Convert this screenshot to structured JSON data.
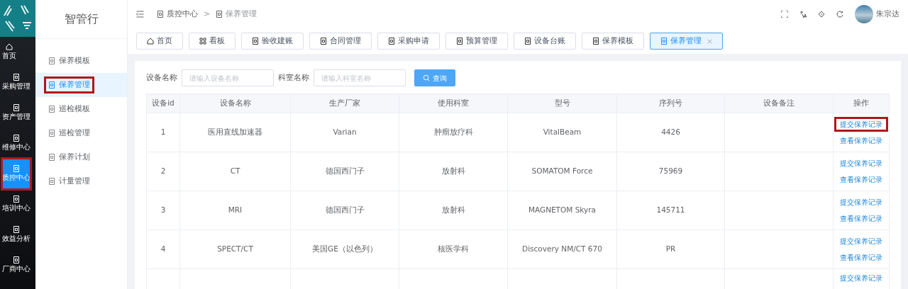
{
  "main_nav": [
    {
      "label": "首页",
      "selected": false,
      "highlighted": false
    },
    {
      "label": "采购管理",
      "selected": false,
      "highlighted": false
    },
    {
      "label": "资产管理",
      "selected": false,
      "highlighted": false
    },
    {
      "label": "维修中心",
      "selected": false,
      "highlighted": false
    },
    {
      "label": "质控中心",
      "selected": true,
      "highlighted": true
    },
    {
      "label": "培训中心",
      "selected": false,
      "highlighted": false
    },
    {
      "label": "效益分析",
      "selected": false,
      "highlighted": false
    },
    {
      "label": "厂商中心",
      "selected": false,
      "highlighted": false
    }
  ],
  "sub_nav": {
    "title": "智管行",
    "items": [
      {
        "label": "保养模板",
        "selected": false,
        "highlighted": false
      },
      {
        "label": "保养管理",
        "selected": true,
        "highlighted": true
      },
      {
        "label": "巡检模板",
        "selected": false,
        "highlighted": false
      },
      {
        "label": "巡检管理",
        "selected": false,
        "highlighted": false
      },
      {
        "label": "保养计划",
        "selected": false,
        "highlighted": false
      },
      {
        "label": "计量管理",
        "selected": false,
        "highlighted": false
      }
    ]
  },
  "breadcrumb": [
    "质控中心",
    ">",
    "保养管理"
  ],
  "user": {
    "name": "朱宗达"
  },
  "tabs": [
    {
      "label": "首页",
      "selected": false,
      "closable": false
    },
    {
      "label": "看板",
      "selected": false,
      "closable": false
    },
    {
      "label": "验收建账",
      "selected": false,
      "closable": false
    },
    {
      "label": "合同管理",
      "selected": false,
      "closable": false
    },
    {
      "label": "采购申请",
      "selected": false,
      "closable": false
    },
    {
      "label": "预算管理",
      "selected": false,
      "closable": false
    },
    {
      "label": "设备台账",
      "selected": false,
      "closable": false
    },
    {
      "label": "保养模板",
      "selected": false,
      "closable": false
    },
    {
      "label": "保养管理",
      "selected": true,
      "closable": true
    }
  ],
  "filters": [
    {
      "label": "设备名称",
      "placeholder": "请输入设备名称"
    },
    {
      "label": "科室名称",
      "placeholder": "请输入科室名称"
    }
  ],
  "search_button": "查询",
  "table": {
    "columns": [
      "设备id",
      "设备名称",
      "生产厂家",
      "使用科室",
      "型号",
      "序列号",
      "设备备注",
      "操作"
    ],
    "rows": [
      {
        "cells": [
          "1",
          "医用直线加速器",
          "Varian",
          "肿瘤放疗科",
          "VitalBeam",
          "4426"
        ],
        "actions": [
          {
            "label": "提交保养记录",
            "highlighted": true
          },
          {
            "label": "查看保养记录",
            "highlighted": false
          }
        ]
      },
      {
        "cells": [
          "2",
          "CT",
          "德国西门子",
          "放射科",
          "SOMATOM Force",
          "75969"
        ],
        "actions": [
          {
            "label": "提交保养记录",
            "highlighted": false
          },
          {
            "label": "查看保养记录",
            "highlighted": false
          }
        ]
      },
      {
        "cells": [
          "3",
          "MRI",
          "德国西门子",
          "放射科",
          "MAGNETOM Skyra",
          "145711"
        ],
        "actions": [
          {
            "label": "提交保养记录",
            "highlighted": false
          },
          {
            "label": "查看保养记录",
            "highlighted": false
          }
        ]
      },
      {
        "cells": [
          "4",
          "SPECT/CT",
          "美国GE（以色列）",
          "核医学科",
          "Discovery NM/CT 670",
          "PR"
        ],
        "actions": [
          {
            "label": "提交保养记录",
            "highlighted": false
          },
          {
            "label": "查看保养记录",
            "highlighted": false
          }
        ]
      },
      {
        "actions": [
          {
            "label": "提交保养记录",
            "highlighted": false
          }
        ]
      }
    ]
  }
}
